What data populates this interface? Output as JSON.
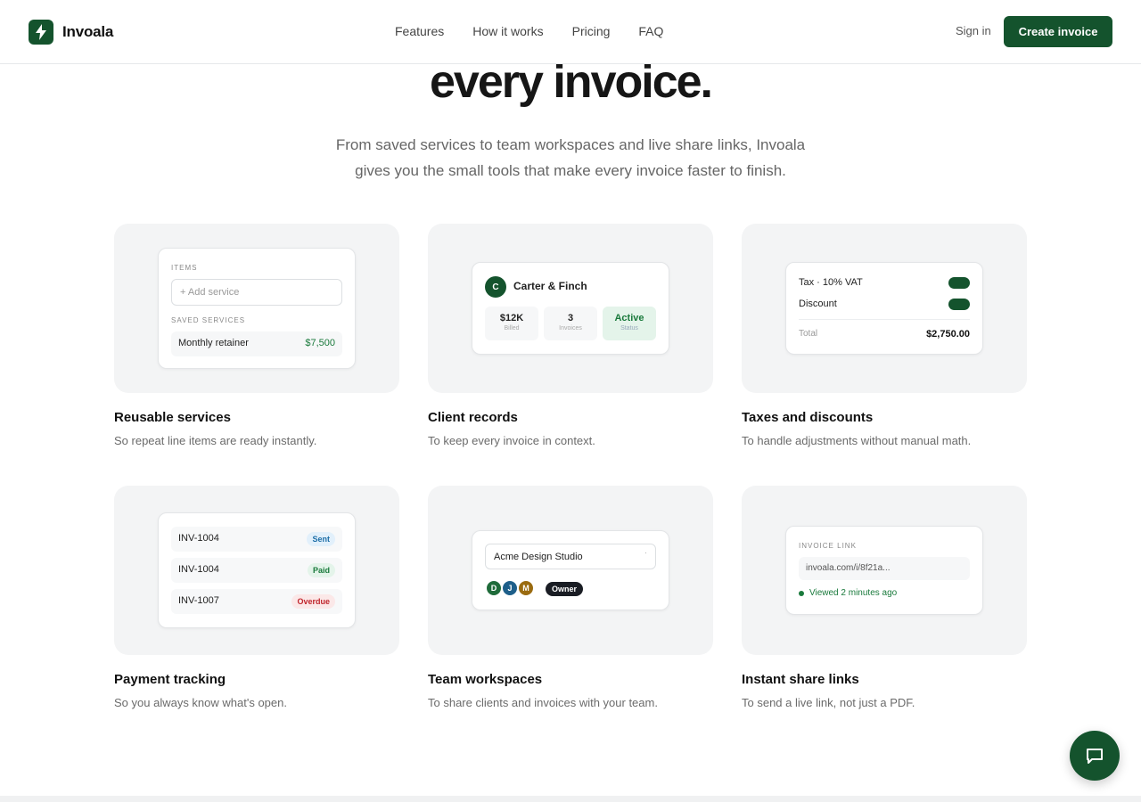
{
  "brand": {
    "name": "Invoala"
  },
  "nav": {
    "links": [
      "Features",
      "How it works",
      "Pricing",
      "FAQ"
    ],
    "signin": "Sign in",
    "cta": "Create invoice"
  },
  "hero": {
    "title": "every invoice.",
    "subtitle_l1": "From saved services to team workspaces and live share links, Invoala",
    "subtitle_l2": "gives you the small tools that make every invoice faster to finish."
  },
  "features": [
    {
      "title": "Reusable services",
      "desc": "So repeat line items are ready instantly.",
      "mock": {
        "items_label": "ITEMS",
        "add_placeholder": "+ Add service",
        "saved_label": "SAVED SERVICES",
        "service_name": "Monthly retainer",
        "service_price": "$7,500"
      }
    },
    {
      "title": "Client records",
      "desc": "To keep every invoice in context.",
      "mock": {
        "initial": "C",
        "client": "Carter & Finch",
        "stats": [
          {
            "value": "$12K",
            "label": "Billed"
          },
          {
            "value": "3",
            "label": "Invoices"
          },
          {
            "value": "Active",
            "label": "Status"
          }
        ]
      }
    },
    {
      "title": "Taxes and discounts",
      "desc": "To handle adjustments without manual math.",
      "mock": {
        "tax": "Tax · 10% VAT",
        "discount": "Discount",
        "total_label": "Total",
        "total_value": "$2,750.00"
      }
    },
    {
      "title": "Payment tracking",
      "desc": "So you always know what's open.",
      "mock": {
        "rows": [
          {
            "id": "INV-1004",
            "status": "Sent"
          },
          {
            "id": "INV-1004",
            "status": "Paid"
          },
          {
            "id": "INV-1007",
            "status": "Overdue"
          }
        ]
      }
    },
    {
      "title": "Team workspaces",
      "desc": "To share clients and invoices with your team.",
      "mock": {
        "workspace": "Acme Design Studio",
        "avatars": [
          "D",
          "J",
          "M"
        ],
        "role": "Owner"
      }
    },
    {
      "title": "Instant share links",
      "desc": "To send a live link, not just a PDF.",
      "mock": {
        "label": "INVOICE LINK",
        "url": "invoala.com/i/8f21a...",
        "viewed": "Viewed 2 minutes ago"
      }
    }
  ],
  "colors": {
    "brand": "#14532d",
    "sent": "#1e6fa8",
    "paid": "#1a7a3c",
    "overdue": "#c0262d"
  },
  "icons": {
    "logo": "bolt-icon",
    "chat": "chat-bubble-icon",
    "select": "chevron-down-icon"
  }
}
